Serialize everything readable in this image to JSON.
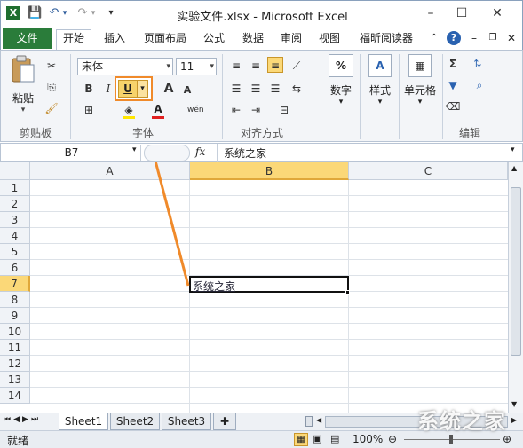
{
  "window": {
    "title": "实验文件.xlsx  -  Microsoft Excel",
    "minimize": "–",
    "maximize": "☐",
    "close": "✕"
  },
  "qat": {
    "save": "💾",
    "undo": "↶",
    "redo": "↷",
    "customize": "▾"
  },
  "tabs": [
    "开始",
    "插入",
    "页面布局",
    "公式",
    "数据",
    "审阅",
    "视图",
    "福昕阅读器"
  ],
  "file_tab": "文件",
  "active_tab": "开始",
  "ribbon": {
    "clipboard": {
      "paste": "粘贴",
      "label": "剪贴板"
    },
    "font": {
      "name": "宋体",
      "size": "11",
      "bold": "B",
      "italic": "I",
      "underline": "U",
      "grow": "A",
      "shrink": "A",
      "wen": "wén",
      "label": "字体"
    },
    "align": {
      "label": "对齐方式"
    },
    "number": {
      "button": "数字",
      "symbol": "%"
    },
    "styles": {
      "button": "样式"
    },
    "cells": {
      "button": "单元格"
    },
    "editing": {
      "label": "编辑",
      "sum": "Σ"
    }
  },
  "formula_bar": {
    "name_box": "B7",
    "fx": "fx",
    "content": "系统之家"
  },
  "columns": [
    "A",
    "B",
    "C"
  ],
  "rows": [
    "1",
    "2",
    "3",
    "4",
    "5",
    "6",
    "7",
    "8",
    "9",
    "10",
    "11",
    "12",
    "13",
    "14"
  ],
  "active_cell": {
    "column": "B",
    "row": "7",
    "value": "系统之家"
  },
  "sheets": [
    "Sheet1",
    "Sheet2",
    "Sheet3"
  ],
  "active_sheet": "Sheet1",
  "status": {
    "ready": "就绪",
    "zoom": "100%"
  },
  "watermark": "系统之家",
  "colors": {
    "file_tab": "#2a7c3a",
    "highlight": "#f7d36b",
    "arrow": "#f08a2a",
    "active_header": "#fbd878"
  }
}
